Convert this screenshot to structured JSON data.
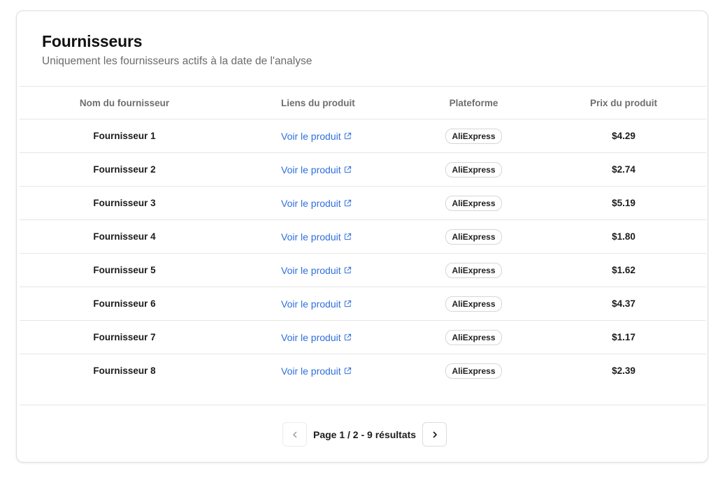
{
  "header": {
    "title": "Fournisseurs",
    "subtitle": "Uniquement les fournisseurs actifs à la date de l'analyse"
  },
  "table": {
    "columns": [
      "Nom du fournisseur",
      "Liens du produit",
      "Plateforme",
      "Prix du produit"
    ],
    "rows": [
      {
        "name": "Fournisseur 1",
        "link": "Voir le produit",
        "platform": "AliExpress",
        "price": "$4.29"
      },
      {
        "name": "Fournisseur 2",
        "link": "Voir le produit",
        "platform": "AliExpress",
        "price": "$2.74"
      },
      {
        "name": "Fournisseur 3",
        "link": "Voir le produit",
        "platform": "AliExpress",
        "price": "$5.19"
      },
      {
        "name": "Fournisseur 4",
        "link": "Voir le produit",
        "platform": "AliExpress",
        "price": "$1.80"
      },
      {
        "name": "Fournisseur 5",
        "link": "Voir le produit",
        "platform": "AliExpress",
        "price": "$1.62"
      },
      {
        "name": "Fournisseur 6",
        "link": "Voir le produit",
        "platform": "AliExpress",
        "price": "$4.37"
      },
      {
        "name": "Fournisseur 7",
        "link": "Voir le produit",
        "platform": "AliExpress",
        "price": "$1.17"
      },
      {
        "name": "Fournisseur 8",
        "link": "Voir le produit",
        "platform": "AliExpress",
        "price": "$2.39"
      }
    ],
    "link_icon": "external-link-icon"
  },
  "pagination": {
    "text": "Page 1 / 2 - 9 résultats",
    "prev_icon": "chevron-left-icon",
    "next_icon": "chevron-right-icon"
  },
  "colors": {
    "link": "#2f6fdc",
    "border": "#e6e6e6",
    "muted": "#6e6e6e"
  }
}
